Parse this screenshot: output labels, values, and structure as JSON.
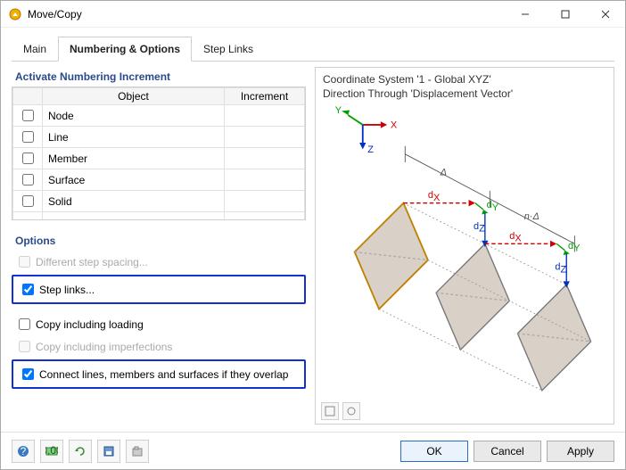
{
  "window": {
    "title": "Move/Copy"
  },
  "tabs": {
    "main": "Main",
    "numbering": "Numbering & Options",
    "steplinks": "Step Links",
    "active": "numbering"
  },
  "numbering": {
    "group_title": "Activate Numbering Increment",
    "columns": {
      "blank": "",
      "object": "Object",
      "increment": "Increment"
    },
    "rows": [
      {
        "checked": false,
        "object": "Node",
        "increment": ""
      },
      {
        "checked": false,
        "object": "Line",
        "increment": ""
      },
      {
        "checked": false,
        "object": "Member",
        "increment": ""
      },
      {
        "checked": false,
        "object": "Surface",
        "increment": ""
      },
      {
        "checked": false,
        "object": "Solid",
        "increment": ""
      }
    ]
  },
  "options": {
    "title": "Options",
    "diff_spacing": {
      "label": "Different step spacing...",
      "checked": false,
      "enabled": false
    },
    "step_links": {
      "label": "Step links...",
      "checked": true,
      "enabled": true
    },
    "copy_loading": {
      "label": "Copy including loading",
      "checked": false,
      "enabled": true
    },
    "copy_imperf": {
      "label": "Copy including imperfections",
      "checked": false,
      "enabled": false
    },
    "connect_overlap": {
      "label": "Connect lines, members and surfaces if they overlap",
      "checked": true,
      "enabled": true
    }
  },
  "preview": {
    "line1": "Coordinate System '1 - Global XYZ'",
    "line2": "Direction Through 'Displacement Vector'",
    "axis": {
      "x": "X",
      "y": "Y",
      "z": "Z"
    },
    "labels": {
      "delta": "Δ",
      "ndelta": "n·Δ",
      "dx": "d",
      "dy": "d",
      "dz": "d",
      "dx_sub": "X",
      "dy_sub": "Y",
      "dz_sub": "Z"
    }
  },
  "footer": {
    "ok": "OK",
    "cancel": "Cancel",
    "apply": "Apply"
  }
}
